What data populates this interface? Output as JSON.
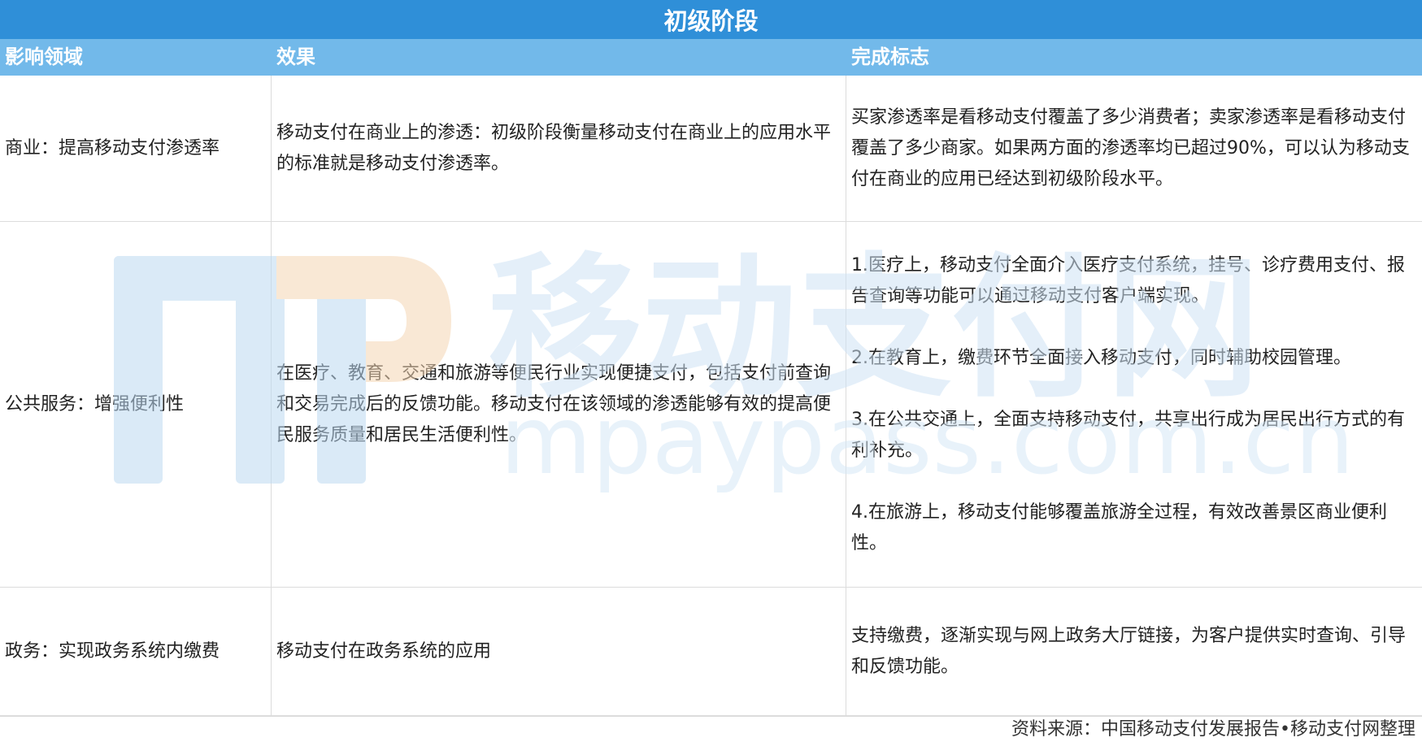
{
  "title": "初级阶段",
  "headers": [
    "影响领域",
    "效果",
    "完成标志"
  ],
  "rows": [
    {
      "domain": "商业：提高移动支付渗透率",
      "effect": "移动支付在商业上的渗透：初级阶段衡量移动支付在商业上的应用水平的标准就是移动支付渗透率。",
      "marks": [
        "买家渗透率是看移动支付覆盖了多少消费者；卖家渗透率是看移动支付覆盖了多少商家。如果两方面的渗透率均已超过90%，可以认为移动支付在商业的应用已经达到初级阶段水平。"
      ]
    },
    {
      "domain": "公共服务：增强便利性",
      "effect": "在医疗、教育、交通和旅游等便民行业实现便捷支付，包括支付前查询和交易完成后的反馈功能。移动支付在该领域的渗透能够有效的提高便民服务质量和居民生活便利性。",
      "marks": [
        "1.医疗上，移动支付全面介入医疗支付系统，挂号、诊疗费用支付、报告查询等功能可以通过移动支付客户端实现。",
        "2.在教育上，缴费环节全面接入移动支付，同时辅助校园管理。",
        "3.在公共交通上，全面支持移动支付，共享出行成为居民出行方式的有利补充。",
        "4.在旅游上，移动支付能够覆盖旅游全过程，有效改善景区商业便利性。"
      ]
    },
    {
      "domain": "政务：实现政务系统内缴费",
      "effect": "移动支付在政务系统的应用",
      "marks": [
        "支持缴费，逐渐实现与网上政务大厅链接，为客户提供实时查询、引导和反馈功能。"
      ]
    }
  ],
  "footer": "资料来源：中国移动支付发展报告•移动支付网整理",
  "watermark": {
    "logo_text": "移动支付网",
    "url_text": "mpaypass.com.cn"
  },
  "colors": {
    "title_bg": "#2f8fd8",
    "header_bg": "#72b9ea",
    "grid_line": "#dcdcdc"
  }
}
